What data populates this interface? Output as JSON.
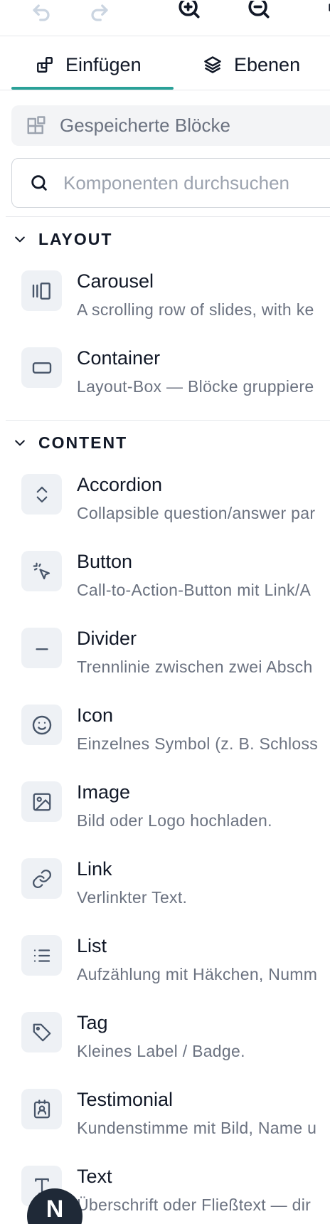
{
  "toolbar": {
    "icons": [
      "undo-icon",
      "redo-icon",
      "zoom-in-icon",
      "zoom-out-icon",
      "more-icon"
    ]
  },
  "tabs": [
    {
      "label": "Einfügen",
      "icon": "insert-blocks-icon",
      "active": true
    },
    {
      "label": "Ebenen",
      "icon": "layers-icon",
      "active": false
    }
  ],
  "saved_blocks": {
    "label": "Gespeicherte Blöcke",
    "icon": "saved-blocks-icon"
  },
  "search": {
    "placeholder": "Komponenten durchsuchen",
    "value": ""
  },
  "sections": [
    {
      "title": "LAYOUT",
      "items": [
        {
          "name": "Carousel",
          "description": "A scrolling row of slides, with ke",
          "icon": "carousel-icon"
        },
        {
          "name": "Container",
          "description": "Layout-Box — Blöcke gruppiere",
          "icon": "container-icon"
        }
      ]
    },
    {
      "title": "CONTENT",
      "items": [
        {
          "name": "Accordion",
          "description": "Collapsible question/answer par",
          "icon": "accordion-icon"
        },
        {
          "name": "Button",
          "description": "Call-to-Action-Button mit Link/A",
          "icon": "button-pointer-icon"
        },
        {
          "name": "Divider",
          "description": "Trennlinie zwischen zwei Absch",
          "icon": "divider-icon"
        },
        {
          "name": "Icon",
          "description": "Einzelnes Symbol (z. B. Schloss",
          "icon": "smiley-icon"
        },
        {
          "name": "Image",
          "description": "Bild oder Logo hochladen.",
          "icon": "image-icon"
        },
        {
          "name": "Link",
          "description": "Verlinkter Text.",
          "icon": "link-icon"
        },
        {
          "name": "List",
          "description": "Aufzählung mit Häkchen, Numm",
          "icon": "list-icon"
        },
        {
          "name": "Tag",
          "description": "Kleines Label / Badge.",
          "icon": "tag-icon"
        },
        {
          "name": "Testimonial",
          "description": "Kundenstimme mit Bild, Name u",
          "icon": "testimonial-icon"
        },
        {
          "name": "Text",
          "description": "Überschrift oder Fließtext — dir",
          "icon": "text-icon"
        }
      ]
    }
  ],
  "avatar": {
    "initial": "N"
  },
  "colors": {
    "accent": "#2aa198",
    "icon_bg": "#eef1f5",
    "muted_text": "#6b7280"
  }
}
